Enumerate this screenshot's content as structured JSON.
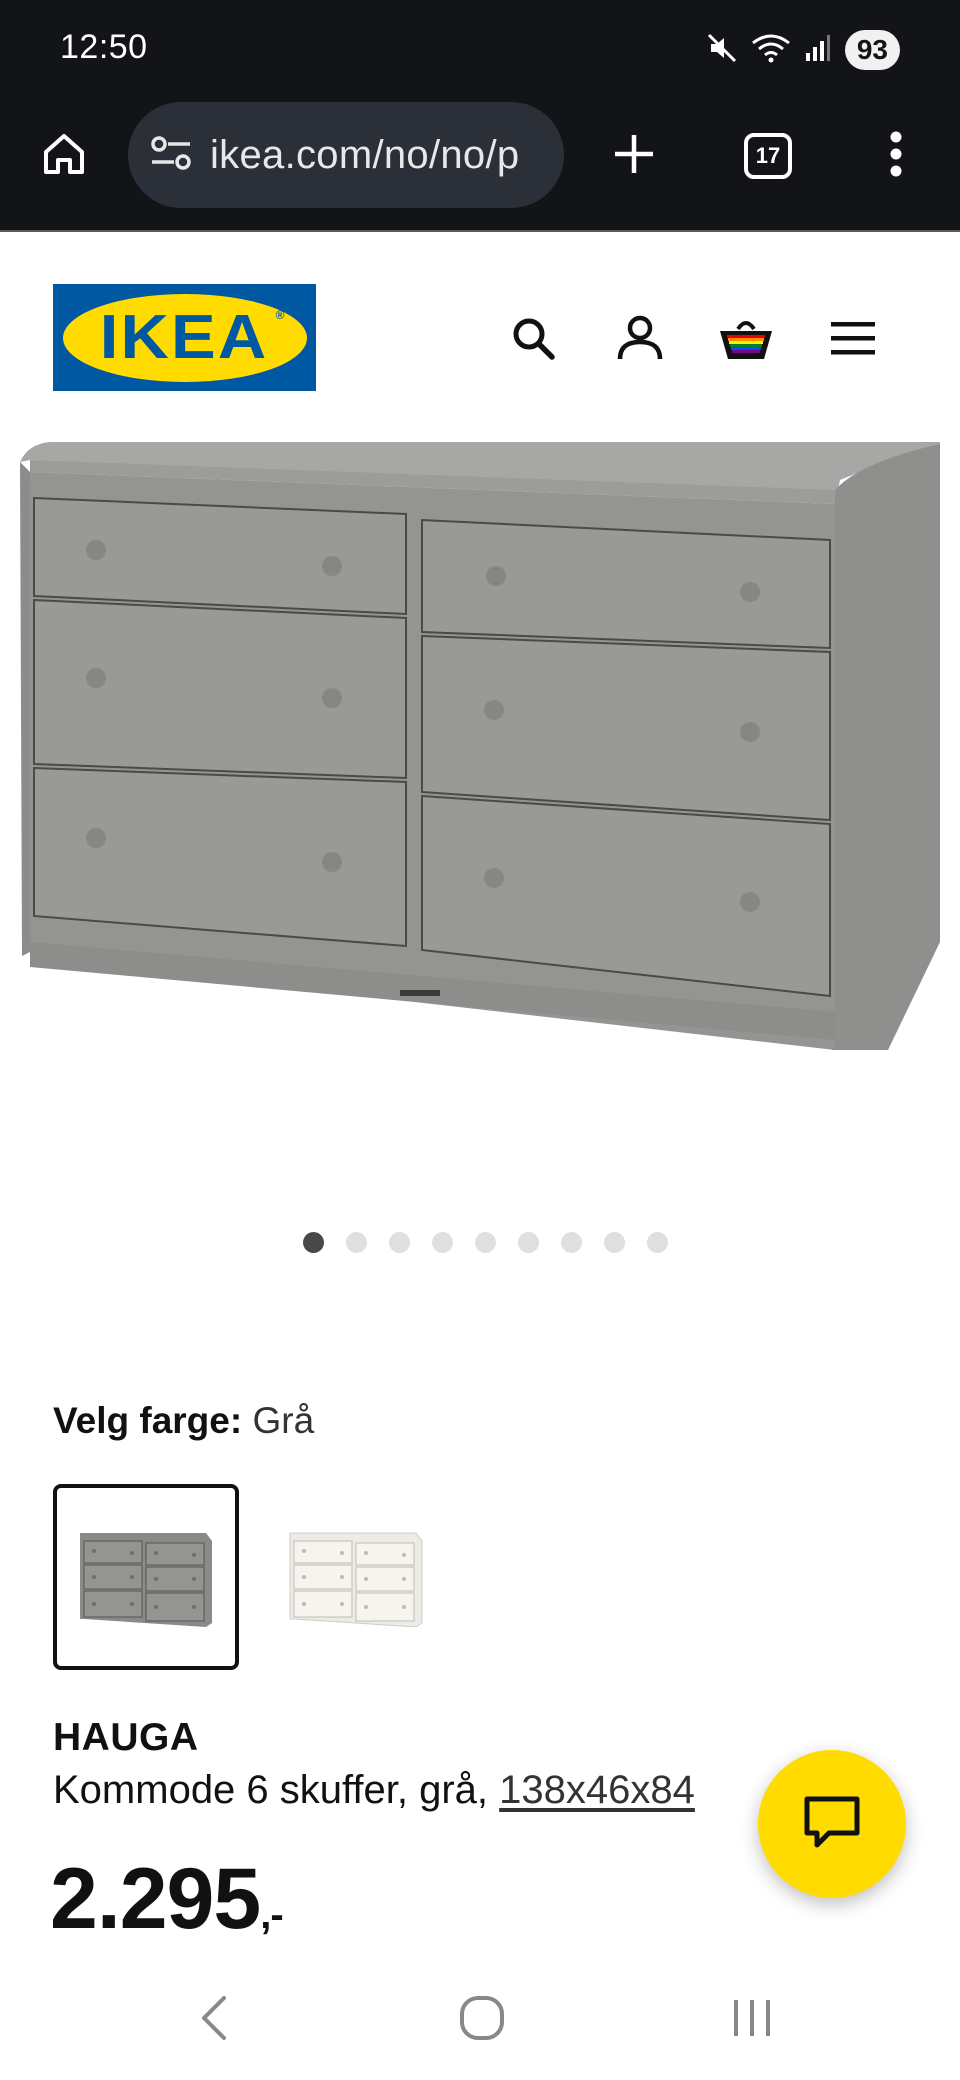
{
  "status_bar": {
    "time": "12:50",
    "battery": "93",
    "icons": [
      "mute-icon",
      "wifi-icon",
      "signal-icon"
    ]
  },
  "browser": {
    "url": "ikea.com/no/no/p",
    "tab_count": "17",
    "icons": [
      "home-icon",
      "site-settings-icon",
      "new-tab-icon",
      "tabs-icon",
      "more-icon"
    ]
  },
  "header": {
    "logo_text": "IKEA",
    "icons": [
      "search-icon",
      "account-icon",
      "basket-icon",
      "menu-icon"
    ]
  },
  "gallery": {
    "image_count": 9,
    "active_index": 0,
    "product_color": "#8f8f8f"
  },
  "color_selector": {
    "label": "Velg farge:",
    "value": "Grå",
    "swatches": [
      {
        "name": "gray",
        "color": "#8a8a8a",
        "selected": true
      },
      {
        "name": "white",
        "color": "#f2f0ea",
        "selected": false
      }
    ]
  },
  "product": {
    "name": "HAUGA",
    "description": "Kommode 6 skuffer, grå, ",
    "dimensions": "138x46x84",
    "price": "2.295",
    "price_suffix": ",-"
  },
  "colors": {
    "ikea_blue": "#0058a3",
    "ikea_yellow": "#ffdb00",
    "chrome_bg": "#121418"
  }
}
